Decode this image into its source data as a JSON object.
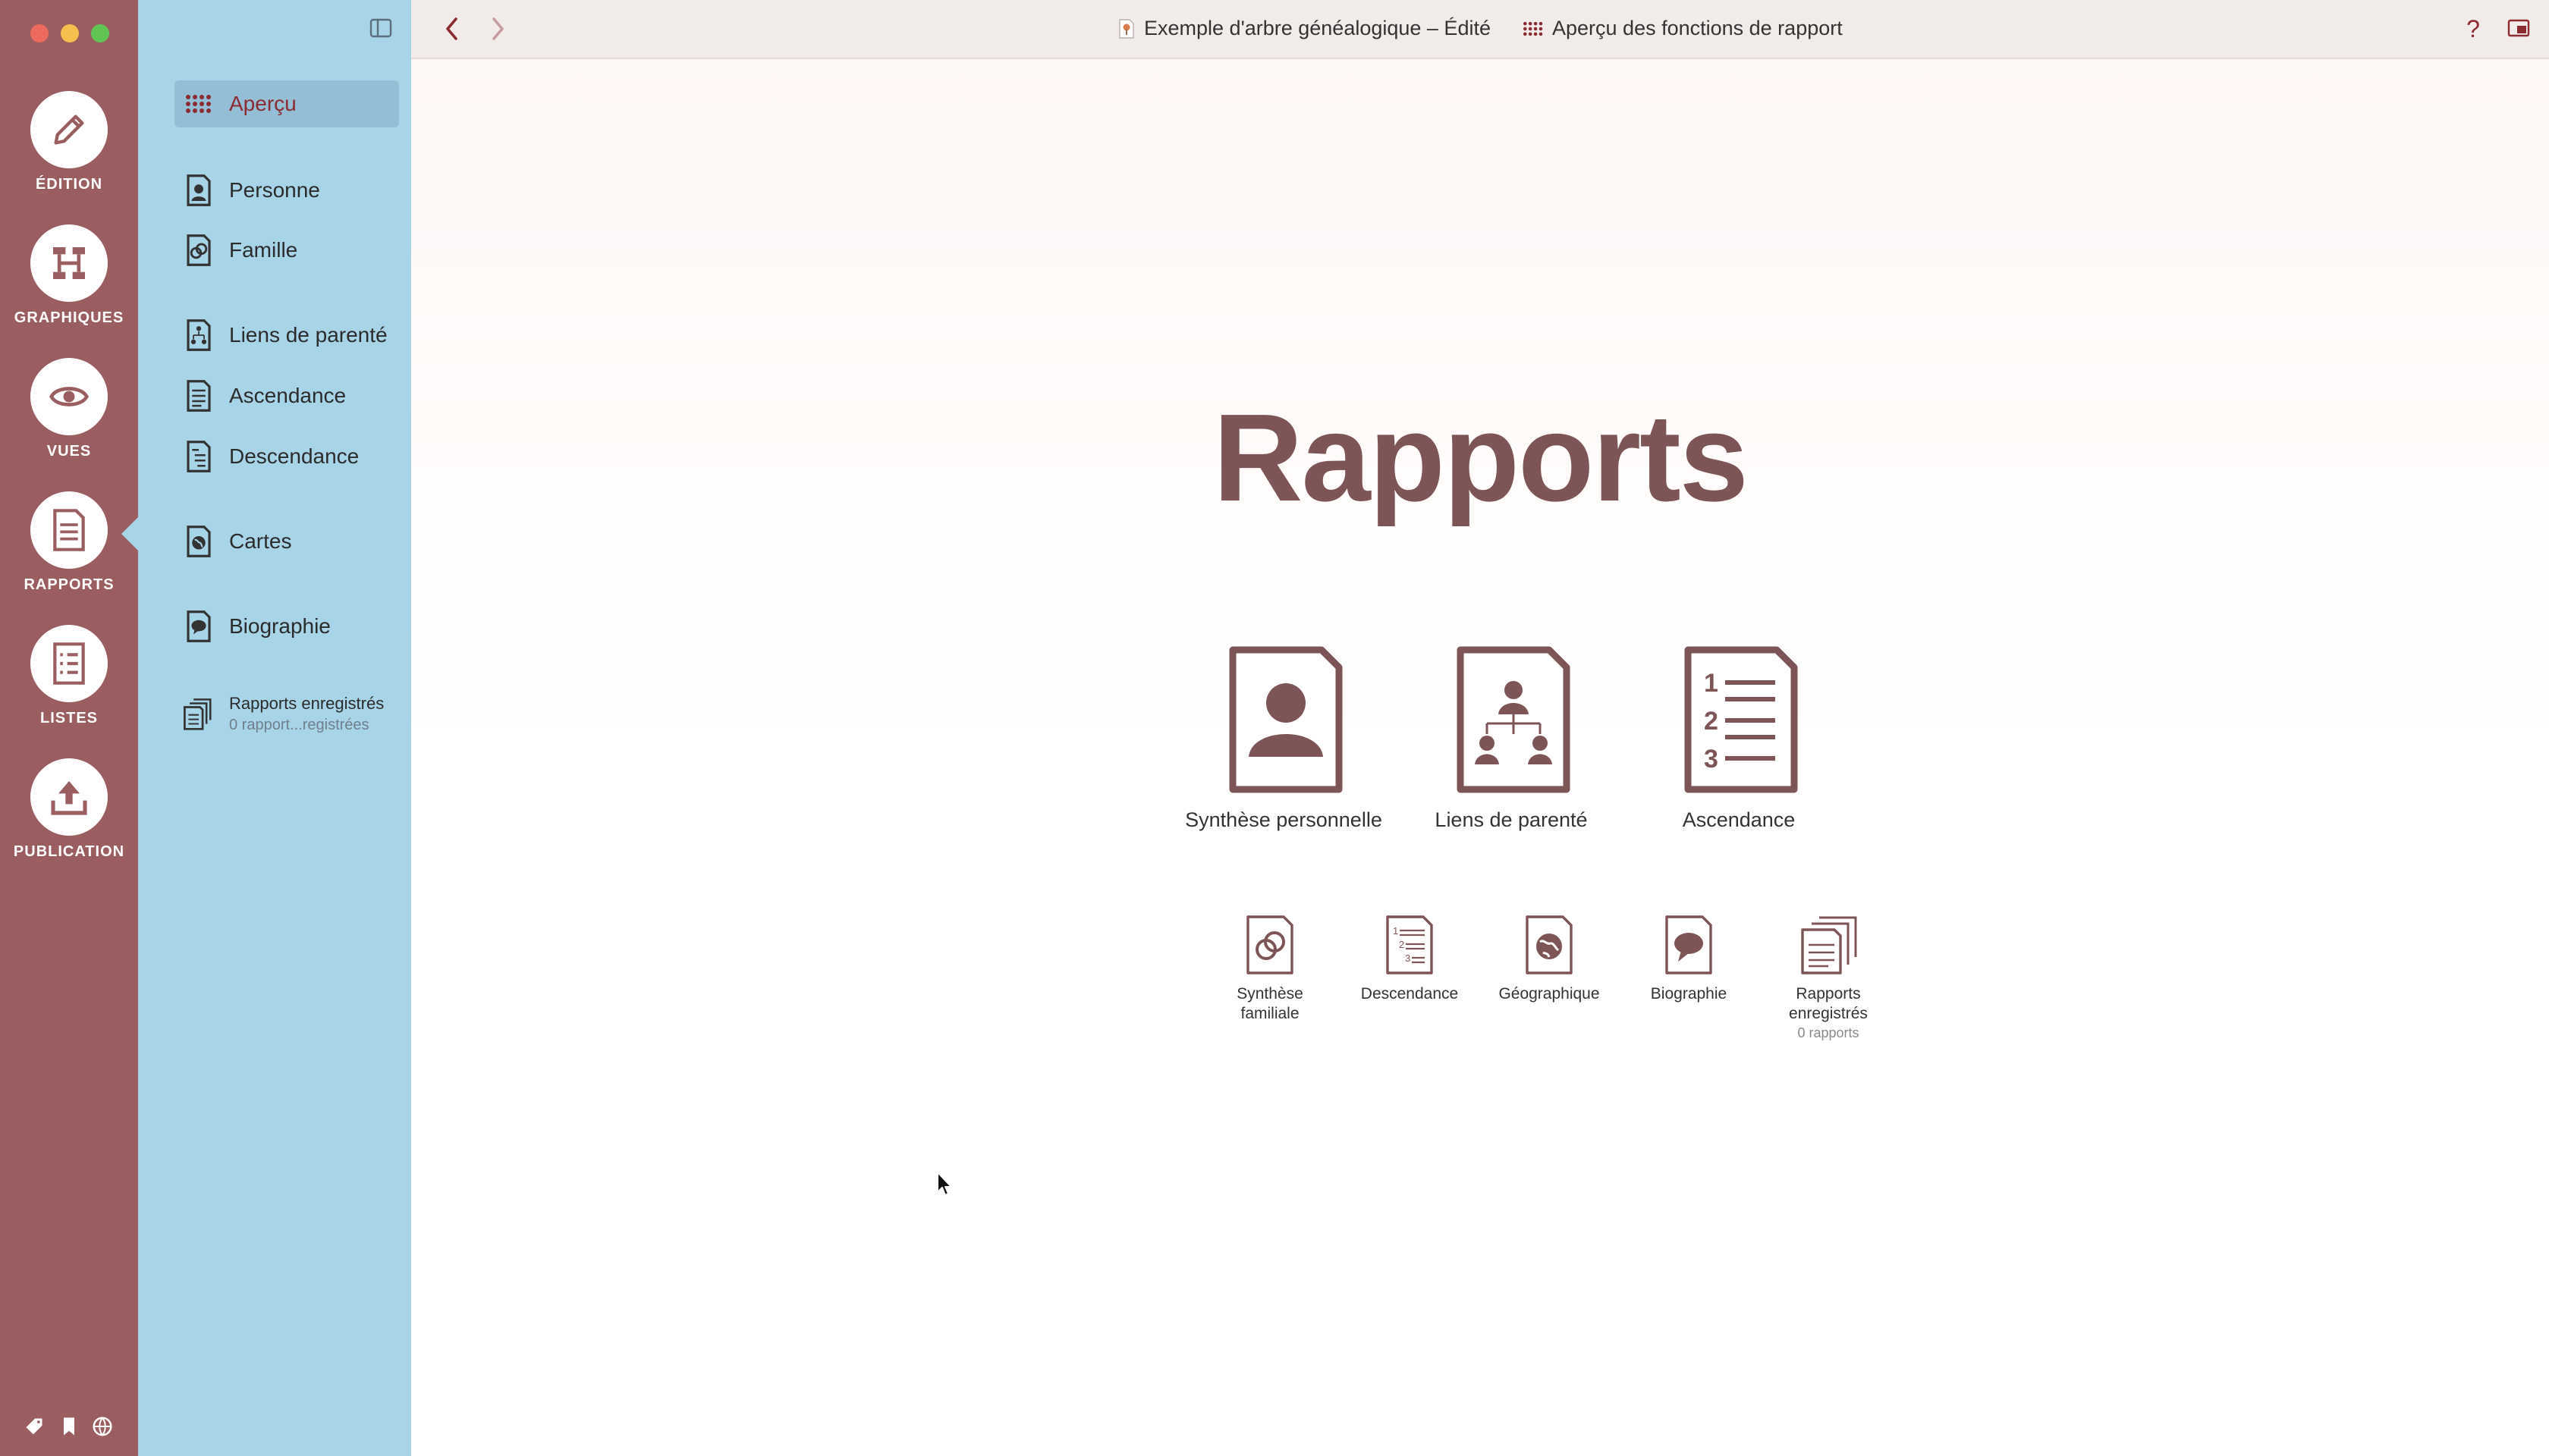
{
  "window": {
    "document_title": "Exemple d'arbre généalogique – Édité",
    "view_title": "Aperçu des fonctions de rapport",
    "help_label": "?"
  },
  "rail": {
    "items": [
      {
        "label": "ÉDITION",
        "icon": "pencil-icon"
      },
      {
        "label": "GRAPHIQUES",
        "icon": "chart-icon"
      },
      {
        "label": "VUES",
        "icon": "eye-icon"
      },
      {
        "label": "RAPPORTS",
        "icon": "report-icon",
        "active": true
      },
      {
        "label": "LISTES",
        "icon": "list-icon"
      },
      {
        "label": "PUBLICATION",
        "icon": "upload-icon"
      }
    ]
  },
  "sidebar": {
    "items": [
      {
        "label": "Aperçu",
        "icon": "grid-icon",
        "active": true
      },
      {
        "label": "Personne",
        "icon": "person-doc-icon"
      },
      {
        "label": "Famille",
        "icon": "rings-doc-icon"
      },
      {
        "label": "Liens de parenté",
        "icon": "tree-doc-icon"
      },
      {
        "label": "Ascendance",
        "icon": "lines-doc-icon"
      },
      {
        "label": "Descendance",
        "icon": "lines-doc-icon"
      },
      {
        "label": "Cartes",
        "icon": "globe-doc-icon"
      },
      {
        "label": "Biographie",
        "icon": "speech-doc-icon"
      }
    ],
    "saved": {
      "label": "Rapports enregistrés",
      "sublabel": "0 rapport...registrées"
    }
  },
  "main": {
    "heading": "Rapports",
    "big_reports": [
      {
        "label": "Synthèse personnelle"
      },
      {
        "label": "Liens de parenté"
      },
      {
        "label": "Ascendance"
      }
    ],
    "small_reports": [
      {
        "line1": "Synthèse",
        "line2": "familiale"
      },
      {
        "line1": "Descendance",
        "line2": ""
      },
      {
        "line1": "Géographique",
        "line2": ""
      },
      {
        "line1": "Biographie",
        "line2": ""
      },
      {
        "line1": "Rapports",
        "line2": "enregistrés",
        "sub": "0 rapports"
      }
    ]
  },
  "colors": {
    "rail": "#9a5e60",
    "sidebar": "#a8d4e8",
    "accent": "#8b2b30",
    "icon": "#7e5557"
  }
}
